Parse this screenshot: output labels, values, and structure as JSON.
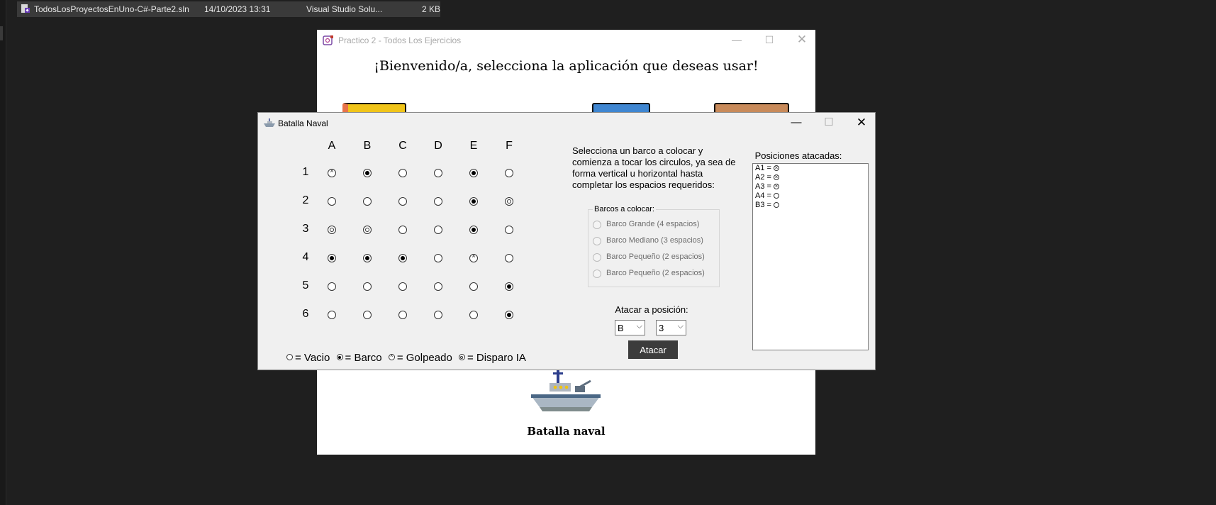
{
  "explorer": {
    "file_name": "TodosLosProyectosEnUno-C#-Parte2.sln",
    "file_date": "14/10/2023 13:31",
    "file_type": "Visual Studio Solu...",
    "file_size": "2 KB"
  },
  "main_window": {
    "title": "Practico 2 - Todos Los Ejercicios",
    "welcome": "¡Bienvenido/a, selecciona la aplicación que deseas usar!",
    "ship_label": "Batalla naval"
  },
  "dialog": {
    "title": "Batalla Naval",
    "columns": [
      "A",
      "B",
      "C",
      "D",
      "E",
      "F"
    ],
    "rows": [
      "1",
      "2",
      "3",
      "4",
      "5",
      "6"
    ],
    "grid": [
      [
        "hit",
        "ship",
        "empty",
        "empty",
        "ship",
        "empty"
      ],
      [
        "empty",
        "empty",
        "empty",
        "empty",
        "ship",
        "ai"
      ],
      [
        "ai",
        "ai",
        "empty",
        "empty",
        "ship",
        "empty"
      ],
      [
        "ship",
        "ship",
        "ship",
        "empty",
        "hit",
        "empty"
      ],
      [
        "empty",
        "empty",
        "empty",
        "empty",
        "empty",
        "ship"
      ],
      [
        "empty",
        "empty",
        "empty",
        "empty",
        "empty",
        "ship"
      ]
    ],
    "legend": {
      "empty": "= Vacio",
      "ship": "= Barco",
      "hit": "= Golpeado",
      "ai": "= Disparo IA"
    },
    "instructions": "Selecciona un barco a colocar y comienza a tocar los circulos, ya sea de forma vertical u horizontal hasta completar los espacios requeridos:",
    "ships_group": {
      "label": "Barcos a colocar:",
      "options": [
        "Barco Grande (4 espacios)",
        "Barco Mediano (3 espacios)",
        "Barco Pequeño (2 espacios)",
        "Barco Pequeño (2 espacios)"
      ]
    },
    "attack": {
      "label": "Atacar a posición:",
      "column_value": "B",
      "row_value": "3",
      "button": "Atacar"
    },
    "attacked": {
      "label": "Posiciones atacadas:",
      "items": [
        {
          "text": "A1 =",
          "state": "hit"
        },
        {
          "text": "A2 =",
          "state": "hit"
        },
        {
          "text": "A3 =",
          "state": "hit"
        },
        {
          "text": "A4 =",
          "state": "empty"
        },
        {
          "text": "B3 =",
          "state": "empty"
        }
      ]
    }
  }
}
